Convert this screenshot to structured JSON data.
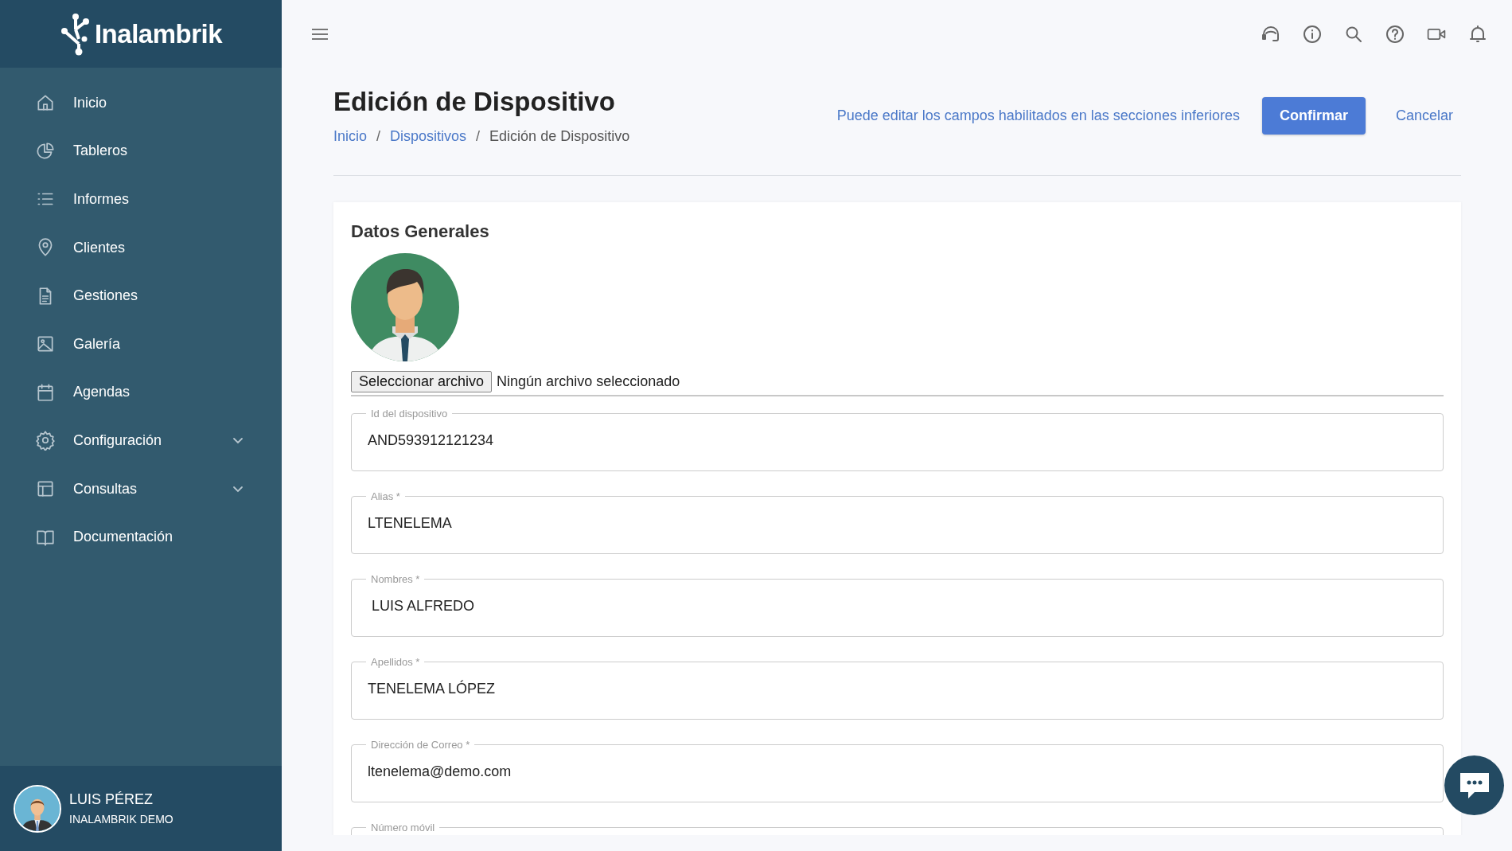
{
  "sidebar": {
    "logo": "Inalambrik",
    "items": [
      {
        "label": "Inicio",
        "kind": "link"
      },
      {
        "label": "Tableros",
        "kind": "link"
      },
      {
        "label": "Informes",
        "kind": "link"
      },
      {
        "label": "Clientes",
        "kind": "link"
      },
      {
        "label": "Gestiones",
        "kind": "link"
      },
      {
        "label": "Galería",
        "kind": "link"
      },
      {
        "label": "Agendas",
        "kind": "link"
      },
      {
        "label": "Configuración",
        "kind": "group",
        "expanded": false
      },
      {
        "label": "Consultas",
        "kind": "group",
        "expanded": false
      },
      {
        "label": "Documentación",
        "kind": "link"
      }
    ],
    "user": {
      "name": "LUIS PÉREZ",
      "company": "INALAMBRIK DEMO"
    }
  },
  "page": {
    "title": "Edición de Dispositivo",
    "breadcrumb": [
      {
        "label": "Inicio",
        "kind": "link"
      },
      {
        "label": "Dispositivos",
        "kind": "link"
      },
      {
        "label": "Edición de Dispositivo",
        "kind": "current"
      }
    ],
    "breadcrumb_separator": "/",
    "hint": "Puede editar los campos habilitados en las secciones inferiores",
    "buttons": {
      "confirm": "Confirmar",
      "cancel": "Cancelar"
    }
  },
  "card": {
    "title": "Datos Generales",
    "file_picker": {
      "button": "Seleccionar archivo",
      "status": "Ningún archivo seleccionado"
    },
    "fields": [
      {
        "label": "Id del dispositivo",
        "value": "AND593912121234"
      },
      {
        "label": "Alias *",
        "value": "LTENELEMA"
      },
      {
        "label": "Nombres *",
        "value": " LUIS ALFREDO"
      },
      {
        "label": "Apellidos *",
        "value": "TENELEMA LÓPEZ"
      },
      {
        "label": "Dirección de Correo *",
        "value": "ltenelema@demo.com"
      },
      {
        "label": "Número móvil"
      }
    ]
  }
}
